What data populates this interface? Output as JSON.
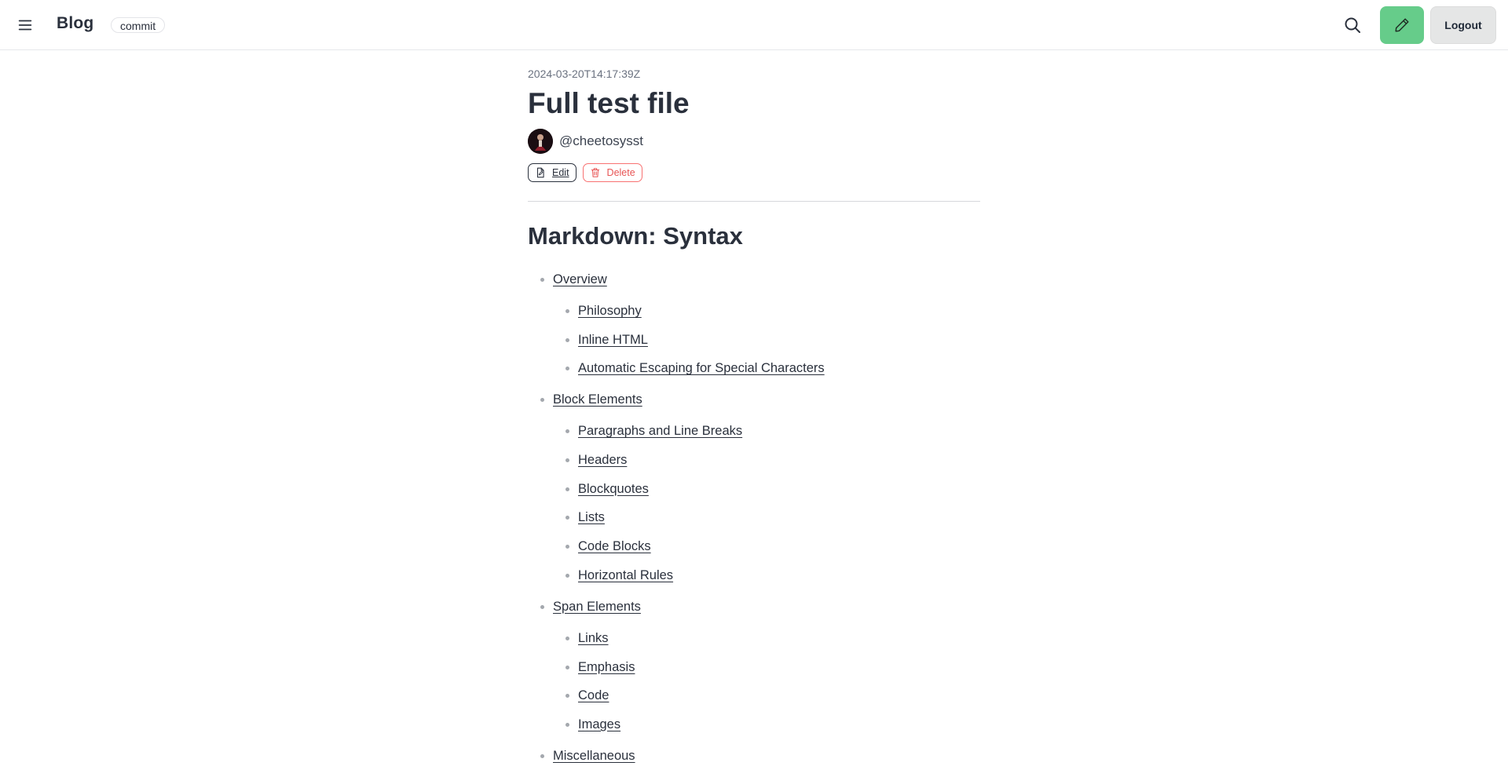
{
  "header": {
    "brand": "Blog",
    "badge": "commit",
    "icons": {
      "menu": "hamburger-menu-icon",
      "search": "search-icon",
      "new_post": "pencil-icon"
    },
    "logout_label": "Logout",
    "accent_color": "#66cc8a"
  },
  "post": {
    "date": "2024-03-20T14:17:39Z",
    "title": "Full test file",
    "author": "@cheetosysst",
    "edit_label": "Edit",
    "delete_label": "Delete",
    "delete_color": "#f87272"
  },
  "content": {
    "heading": "Markdown: Syntax",
    "toc": [
      {
        "label": "Overview",
        "children": [
          "Philosophy",
          "Inline HTML",
          "Automatic Escaping for Special Characters"
        ]
      },
      {
        "label": "Block Elements",
        "children": [
          "Paragraphs and Line Breaks",
          "Headers",
          "Blockquotes",
          "Lists",
          "Code Blocks",
          "Horizontal Rules"
        ]
      },
      {
        "label": "Span Elements",
        "children": [
          "Links",
          "Emphasis",
          "Code",
          "Images"
        ]
      },
      {
        "label": "Miscellaneous",
        "children": []
      }
    ]
  }
}
